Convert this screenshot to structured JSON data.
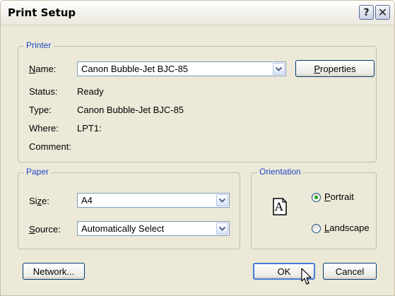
{
  "window": {
    "title": "Print Setup",
    "help_glyph": "?",
    "close_glyph": "✕"
  },
  "printer": {
    "legend": "Printer",
    "name_label": "Name:",
    "name_value": "Canon Bubble-Jet BJC-85",
    "properties_label": "Properties",
    "status_label": "Status:",
    "status_value": "Ready",
    "type_label": "Type:",
    "type_value": "Canon Bubble-Jet BJC-85",
    "where_label": "Where:",
    "where_value": "LPT1:",
    "comment_label": "Comment:"
  },
  "paper": {
    "legend": "Paper",
    "size_label": "Size:",
    "size_value": "A4",
    "source_label": "Source:",
    "source_value": "Automatically Select"
  },
  "orientation": {
    "legend": "Orientation",
    "icon_letter": "A",
    "portrait_label": "Portrait",
    "landscape_label": "Landscape",
    "selected": "Portrait"
  },
  "buttons": {
    "network": "Network...",
    "ok": "OK",
    "cancel": "Cancel"
  },
  "icons": [
    "help-icon",
    "close-icon",
    "chevron-down-icon",
    "page-icon",
    "mouse-cursor-icon"
  ],
  "colors": {
    "legend": "#1f47c8",
    "dialog_bg": "#ece9d8",
    "button_border": "#003c74"
  }
}
